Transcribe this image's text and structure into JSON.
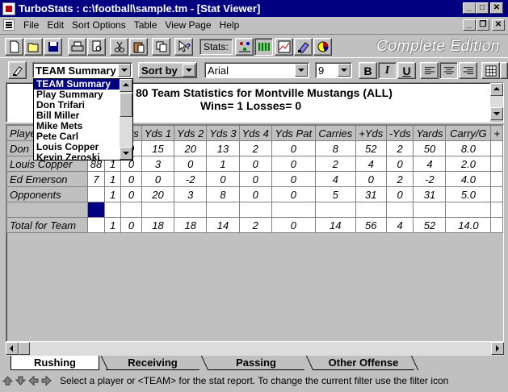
{
  "window": {
    "title": "TurboStats : c:\\football\\sample.tm - [Stat Viewer]"
  },
  "menu": [
    "File",
    "Edit",
    "Sort Options",
    "Table",
    "View Page",
    "Help"
  ],
  "toolbar": {
    "stats_label": "Stats:",
    "edition": "Complete Edition"
  },
  "format_bar": {
    "report_select": "TEAM Summary",
    "sort_select": "Sort by",
    "font_select": "Arial",
    "size_select": "9",
    "bold": "B",
    "italic": "I",
    "underline": "U"
  },
  "dropdown": {
    "options": [
      "TEAM Summary",
      "Play Summary",
      "Don Trifari",
      "Bill Miller",
      "Mike Mets",
      "Pete Carl",
      "Louis Copper",
      "Kevin Zeroski"
    ],
    "selected_index": 0
  },
  "report_header": {
    "title": "80 Team Statistics for Montville Mustangs (ALL)",
    "record": "Wins=  1 Losses=  0"
  },
  "grid": {
    "columns": [
      "Player",
      "",
      "",
      "Pts",
      "Yds 1",
      "Yds 2",
      "Yds 3",
      "Yds 4",
      "Yds Pat",
      "Carries",
      "+Yds",
      "-Yds",
      "Yards",
      "Carry/G",
      "+"
    ],
    "rows": [
      [
        "Don Trifari",
        "",
        "",
        "0",
        "15",
        "20",
        "13",
        "2",
        "0",
        "8",
        "52",
        "2",
        "50",
        "8.0",
        ""
      ],
      [
        "Louis Copper",
        "88",
        "1",
        "0",
        "3",
        "0",
        "1",
        "0",
        "0",
        "2",
        "4",
        "0",
        "4",
        "2.0",
        ""
      ],
      [
        "Ed Emerson",
        "7",
        "1",
        "0",
        "0",
        "-2",
        "0",
        "0",
        "0",
        "4",
        "0",
        "2",
        "-2",
        "4.0",
        ""
      ],
      [
        "Opponents",
        "",
        "1",
        "0",
        "20",
        "3",
        "8",
        "0",
        "0",
        "5",
        "31",
        "0",
        "31",
        "5.0",
        ""
      ],
      [
        "",
        "",
        "",
        "",
        "",
        "",
        "",
        "",
        "",
        "",
        "",
        "",
        "",
        "",
        ""
      ],
      [
        "Total for Team",
        "",
        "1",
        "0",
        "18",
        "18",
        "14",
        "2",
        "0",
        "14",
        "56",
        "4",
        "52",
        "14.0",
        ""
      ]
    ]
  },
  "tabs": [
    "Rushing",
    "Receiving",
    "Passing",
    "Other Offense"
  ],
  "active_tab": 0,
  "status": "Select a player or <TEAM> for the stat report.  To change the current filter use the filter icon",
  "colors": {
    "titlebar": "#000080",
    "selection": "#000080",
    "face": "#c0c0c0"
  }
}
